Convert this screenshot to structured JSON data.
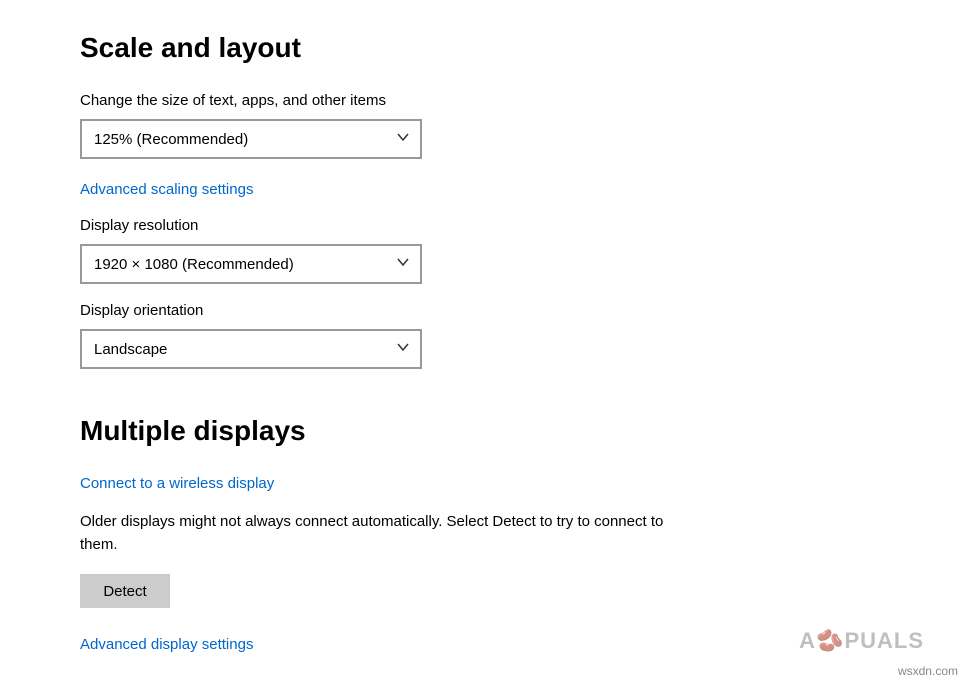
{
  "scaleLayout": {
    "heading": "Scale and layout",
    "scale": {
      "label": "Change the size of text, apps, and other items",
      "value": "125% (Recommended)"
    },
    "advancedScalingLink": "Advanced scaling settings",
    "resolution": {
      "label": "Display resolution",
      "value": "1920 × 1080 (Recommended)"
    },
    "orientation": {
      "label": "Display orientation",
      "value": "Landscape"
    }
  },
  "multipleDisplays": {
    "heading": "Multiple displays",
    "connectWirelessLink": "Connect to a wireless display",
    "olderDisplaysText": "Older displays might not always connect automatically. Select Detect to try to connect to them.",
    "detectButton": "Detect",
    "advancedDisplayLink": "Advanced display settings"
  },
  "watermark": "wsxdn.com",
  "logoText": "A PUALS"
}
